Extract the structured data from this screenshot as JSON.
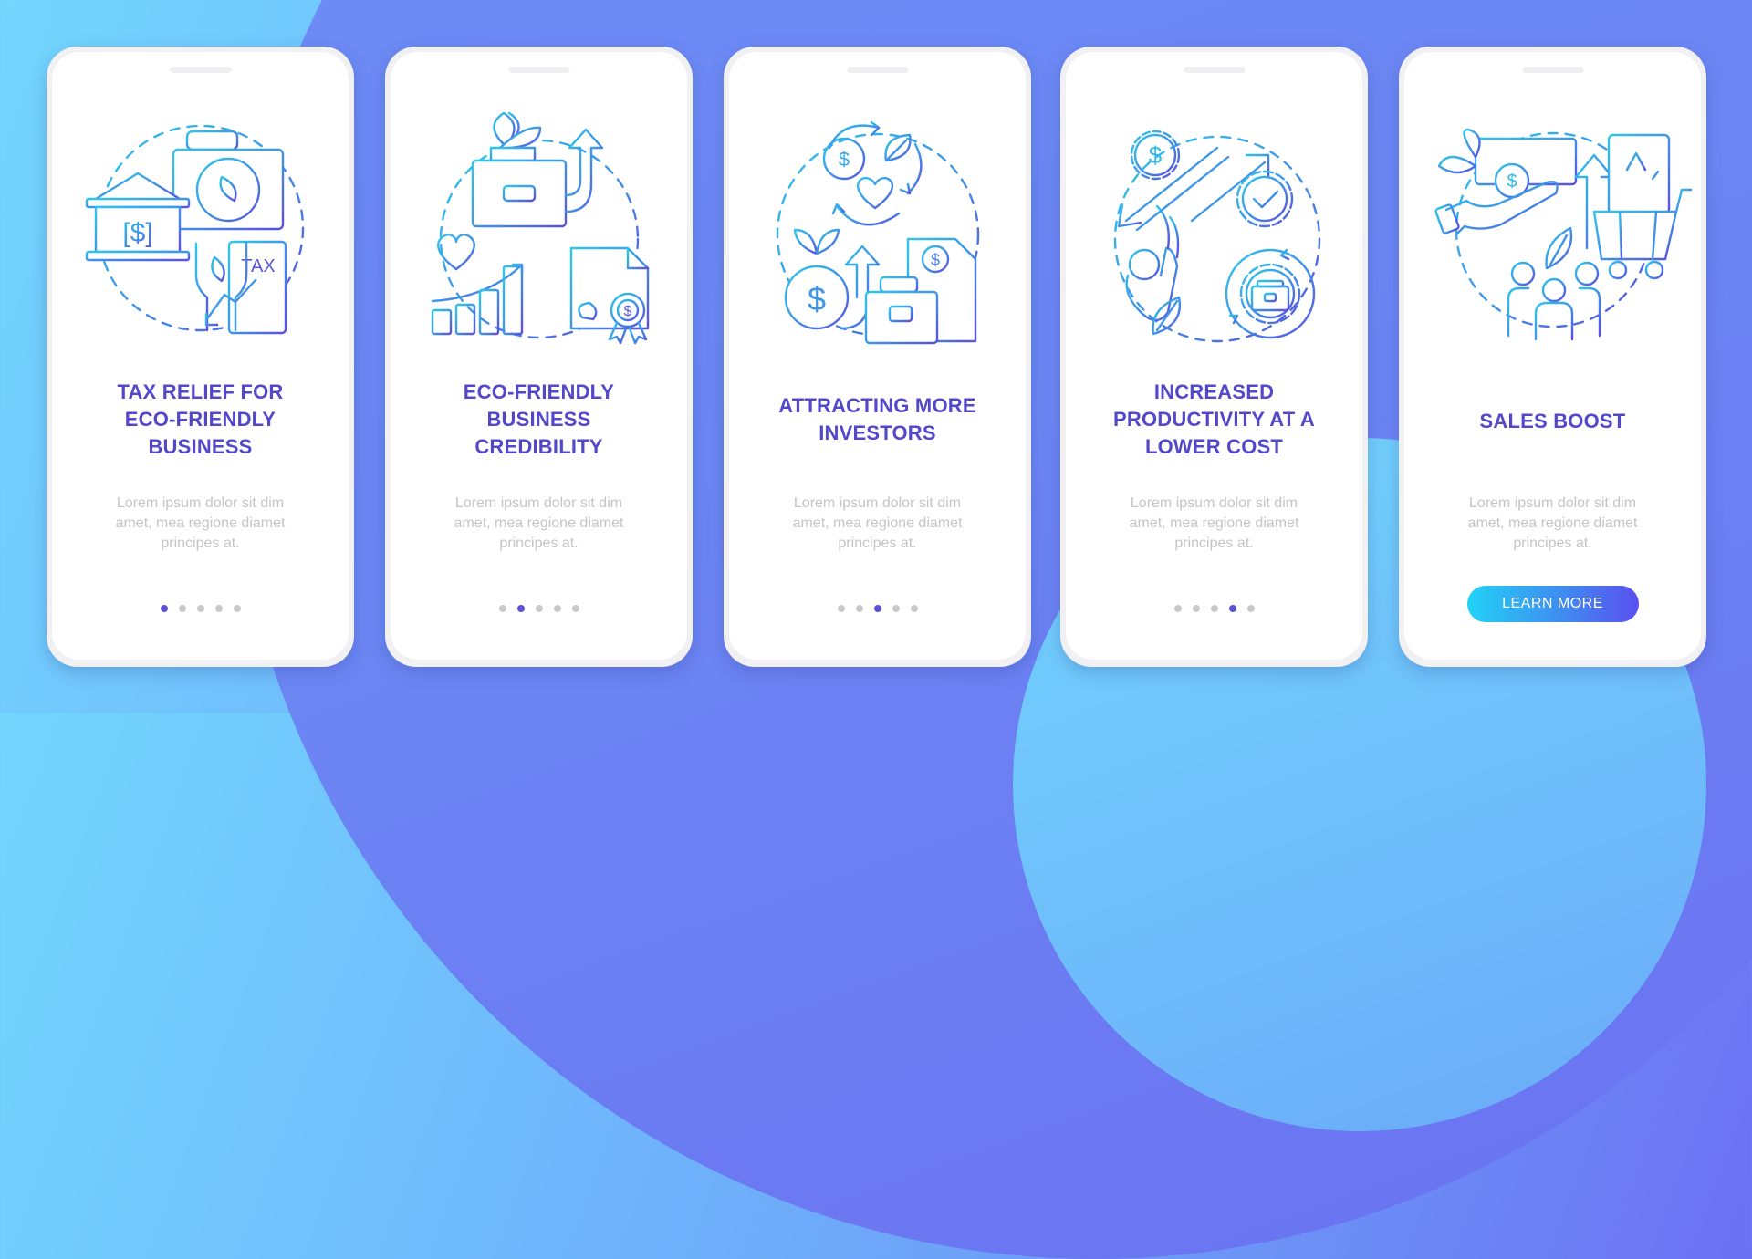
{
  "colors": {
    "accent": "#5348c9",
    "dot_active": "#5a52d8",
    "dot_inactive": "#c9c9cb",
    "body_text": "#c5c5c7",
    "icon_gradient_start": "#2fc6ec",
    "icon_gradient_end": "#5a4fe0",
    "button_gradient_start": "#22d2f6",
    "button_gradient_end": "#5a4ff0"
  },
  "cards": [
    {
      "illustration": "tax-relief-icon",
      "title": "TAX RELIEF FOR ECO-FRIENDLY BUSINESS",
      "body": "Lorem ipsum dolor sit dim amet, mea regione diamet principes at.",
      "active_page": 1,
      "tax_label": "TAX"
    },
    {
      "illustration": "eco-credibility-icon",
      "title": "ECO-FRIENDLY BUSINESS CREDIBILITY",
      "body": "Lorem ipsum dolor sit dim amet, mea regione diamet principes at.",
      "active_page": 2
    },
    {
      "illustration": "attracting-investors-icon",
      "title": "ATTRACTING MORE INVESTORS",
      "body": "Lorem ipsum dolor sit dim amet, mea regione diamet principes at.",
      "active_page": 3
    },
    {
      "illustration": "productivity-icon",
      "title": "INCREASED PRODUCTIVITY AT A LOWER COST",
      "body": "Lorem ipsum dolor sit dim amet, mea regione diamet principes at.",
      "active_page": 4
    },
    {
      "illustration": "sales-boost-icon",
      "title": "SALES BOOST",
      "body": "Lorem ipsum dolor sit dim amet, mea regione diamet principes at.",
      "button_label": "LEARN MORE"
    }
  ],
  "pagination": {
    "total_pages": 5
  }
}
